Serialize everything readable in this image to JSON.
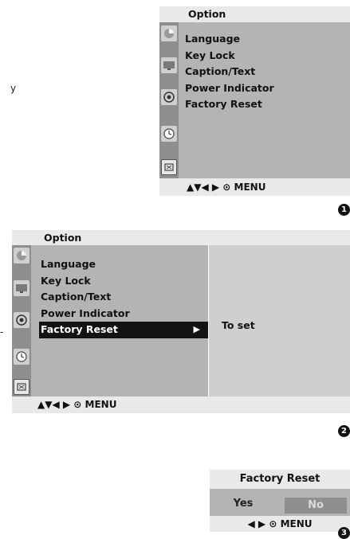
{
  "stray_texts": [
    "y",
    "-"
  ],
  "panel1": {
    "title": "Option",
    "items": [
      "Language",
      "Key Lock",
      "Caption/Text",
      "Power Indicator",
      "Factory Reset"
    ],
    "footer_arrows": "▲▼◀ ▶",
    "footer_menu": "MENU",
    "step": "1"
  },
  "panel2": {
    "title": "Option",
    "items": [
      "Language",
      "Key Lock",
      "Caption/Text",
      "Power Indicator",
      "Factory Reset"
    ],
    "selected_index": 4,
    "selected_arrow": "▶",
    "sub_text": "To set",
    "footer_arrows": "▲▼◀ ▶",
    "footer_menu": "MENU",
    "step": "2"
  },
  "dialog": {
    "title": "Factory Reset",
    "yes_label": "Yes",
    "no_label": "No",
    "footer_arrows": "◀ ▶",
    "footer_menu": "MENU",
    "step": "3"
  },
  "icons": [
    "picture-icon",
    "screen-icon",
    "speaker-icon",
    "clock-icon",
    "option-icon"
  ],
  "colors": {
    "panel_bg": "#b4b4b4",
    "title_bg": "#e9e9e9",
    "icon_column_bg": "#8e8e8e",
    "selected_bg": "#131313",
    "sub_pane_bg": "#cfcfcf",
    "no_button_bg": "#8f8f8f"
  }
}
